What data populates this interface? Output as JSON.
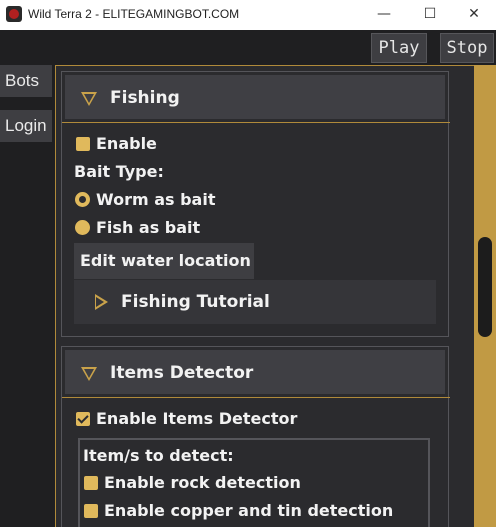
{
  "window": {
    "title": "Wild Terra 2 - ELITEGAMINGBOT.COM",
    "minimize_glyph": "—",
    "maximize_glyph": "☐",
    "close_glyph": "✕"
  },
  "toolbar": {
    "play_label": "Play",
    "stop_label": "Stop"
  },
  "sidebar": {
    "items": [
      {
        "label": "Bots"
      },
      {
        "label": "Login"
      }
    ]
  },
  "fishing": {
    "title": "Fishing",
    "enable_label": "Enable",
    "enable_checked": false,
    "bait_type_label": "Bait Type:",
    "bait_options": [
      {
        "label": "Worm as bait",
        "selected": true
      },
      {
        "label": "Fish as bait",
        "selected": false
      }
    ],
    "edit_water_label": "Edit water location",
    "tutorial_label": "Fishing Tutorial"
  },
  "items_detector": {
    "title": "Items Detector",
    "enable_label": "Enable Items Detector",
    "enable_checked": true,
    "detect_label": "Item/s to detect:",
    "options": [
      {
        "label": "Enable rock detection",
        "checked": false
      },
      {
        "label": "Enable copper and tin detection",
        "checked": false
      }
    ]
  },
  "colors": {
    "accent_gold": "#e0b95c",
    "frame_gold": "#b08a3a",
    "panel": "#2b2b2e",
    "header": "#3f3f44",
    "button": "#3e3e42"
  },
  "icons": [
    "app-icon",
    "chevron-down-icon",
    "chevron-right-icon",
    "checkbox-icon",
    "radio-icon"
  ]
}
